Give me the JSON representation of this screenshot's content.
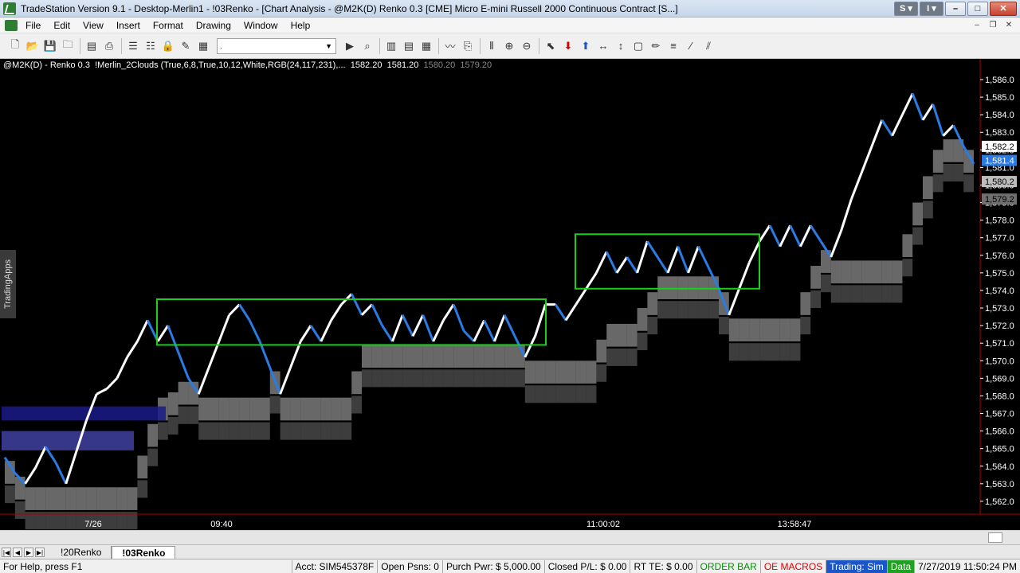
{
  "window": {
    "title": "TradeStation Version 9.1 - Desktop-Merlin1 - !03Renko - [Chart Analysis - @M2K(D) Renko 0.3 [CME] Micro E-mini Russell 2000 Continuous Contract [S...]",
    "s_button": "S ▾",
    "i_button": "I ▾"
  },
  "menu": [
    "File",
    "Edit",
    "View",
    "Insert",
    "Format",
    "Drawing",
    "Window",
    "Help"
  ],
  "toolbar": {
    "combo_value": "."
  },
  "chart_header": {
    "symbol": "@M2K(D) - Renko 0.3",
    "indicator": "!Merlin_2Clouds (True,6,8,True,10,12,White,RGB(24,117,231),...",
    "v1": "1582.20",
    "v2": "1581.20",
    "v3": "1580.20",
    "v4": "1579.20"
  },
  "side_tab": "TradingApps",
  "price_axis": {
    "ticks": [
      "1,586.0",
      "1,585.0",
      "1,584.0",
      "1,583.0",
      "1,582.0",
      "1,581.0",
      "1,580.0",
      "1,579.0",
      "1,578.0",
      "1,577.0",
      "1,576.0",
      "1,575.0",
      "1,574.0",
      "1,573.0",
      "1,572.0",
      "1,571.0",
      "1,570.0",
      "1,569.0",
      "1,568.0",
      "1,567.0",
      "1,566.0",
      "1,565.0",
      "1,564.0",
      "1,563.0",
      "1,562.0"
    ],
    "marker_1": "1,582.2",
    "marker_2": "1,581.4",
    "marker_3": "1,580.2",
    "marker_4": "1,579.2"
  },
  "time_axis": [
    "7/26",
    "09:40",
    "11:00:02",
    "13:58:47"
  ],
  "tabs": [
    "!20Renko",
    "!03Renko"
  ],
  "status": {
    "help": "For Help, press F1",
    "acct": "Acct: SIM545378F",
    "open_psns": "Open Psns: 0",
    "purch_pwr": "Purch Pwr: $ 5,000.00",
    "closed_pl": "Closed P/L: $ 0.00",
    "rt_te": "RT TE: $ 0.00",
    "order_bar": "ORDER BAR",
    "oe_macros": "OE MACROS",
    "trading": "Trading: Sim",
    "data": "Data",
    "datetime": "7/27/2019 11:50:24 PM"
  },
  "chart_data": {
    "type": "line",
    "ylim": [
      1561.5,
      1586.5
    ],
    "brick_size": 0.3,
    "path": [
      1564.5,
      1563.6,
      1563.0,
      1563.9,
      1565.1,
      1564.2,
      1563.0,
      1564.8,
      1566.6,
      1568.1,
      1568.4,
      1569.0,
      1570.2,
      1571.1,
      1572.3,
      1571.1,
      1572.0,
      1570.5,
      1569.0,
      1568.1,
      1569.6,
      1571.1,
      1572.6,
      1573.2,
      1572.3,
      1571.1,
      1569.6,
      1568.1,
      1569.6,
      1571.1,
      1572.0,
      1571.1,
      1572.3,
      1573.2,
      1573.8,
      1572.6,
      1573.2,
      1572.0,
      1571.1,
      1572.6,
      1571.4,
      1572.6,
      1571.1,
      1572.3,
      1573.2,
      1571.7,
      1571.1,
      1572.3,
      1571.1,
      1572.6,
      1571.4,
      1570.2,
      1571.4,
      1573.2,
      1573.2,
      1572.3,
      1573.2,
      1574.1,
      1575.0,
      1576.2,
      1575.0,
      1575.9,
      1575.0,
      1576.8,
      1575.9,
      1575.0,
      1576.5,
      1575.0,
      1576.5,
      1575.3,
      1574.1,
      1572.6,
      1574.1,
      1575.6,
      1576.8,
      1577.7,
      1576.5,
      1577.7,
      1576.5,
      1577.7,
      1576.8,
      1575.9,
      1577.4,
      1579.2,
      1580.7,
      1582.2,
      1583.7,
      1582.8,
      1584.0,
      1585.2,
      1583.7,
      1584.6,
      1582.8,
      1583.4,
      1582.2,
      1581.2
    ]
  }
}
